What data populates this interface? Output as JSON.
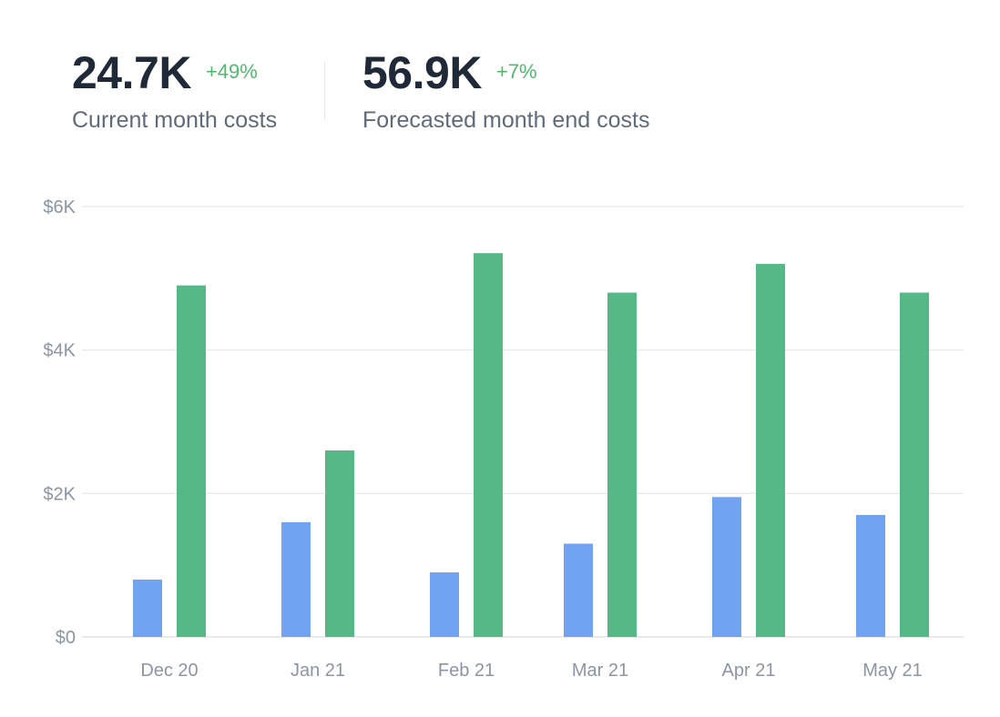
{
  "kpis": [
    {
      "value": "24.7K",
      "change": "+49%",
      "label": "Current month costs"
    },
    {
      "value": "56.9K",
      "change": "+7%",
      "label": "Forecasted month end costs"
    }
  ],
  "colors": {
    "series_current": "#72a3f3",
    "series_forecast": "#55b886",
    "positive_change": "#4cbb6c",
    "gridline": "#e5e7ea",
    "axis_text": "#8b95a5"
  },
  "chart_data": {
    "type": "bar",
    "categories": [
      "Dec 20",
      "Jan 21",
      "Feb 21",
      "Mar 21",
      "Apr 21",
      "May 21"
    ],
    "series": [
      {
        "values": [
          800,
          1600,
          900,
          1300,
          1950,
          1700
        ]
      },
      {
        "values": [
          4900,
          2600,
          5350,
          4800,
          5200,
          4800
        ]
      }
    ],
    "ylim": [
      0,
      6000
    ],
    "yticks": [
      0,
      2000,
      4000,
      6000
    ],
    "ytick_labels": [
      "$0",
      "$2K",
      "$4K",
      "$6K"
    ],
    "grid": true,
    "title": "",
    "xlabel": "",
    "ylabel": ""
  }
}
